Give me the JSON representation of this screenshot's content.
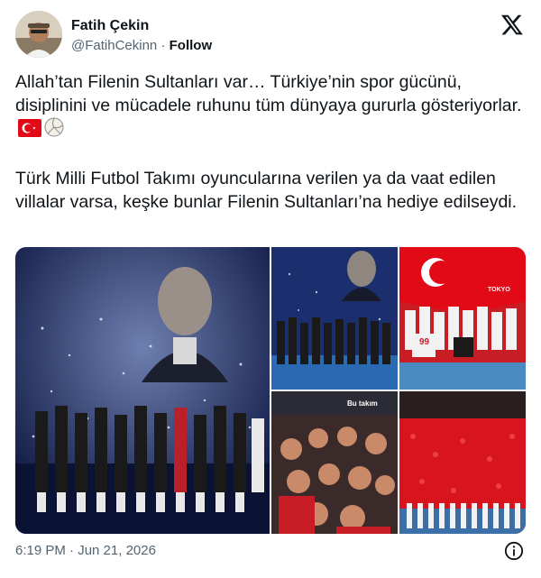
{
  "author": {
    "display_name": "Fatih Çekin",
    "handle": "@FatihCekinn",
    "separator": "·",
    "follow_label": "Follow"
  },
  "tweet": {
    "paragraph1": "Allah’tan Filenin Sultanları var… Türkiye’nin spor gücünü, disiplinini ve mücadele ruhunu tüm dünyaya gururla gösteriyorlar.",
    "paragraph2": "Türk Milli Futbol Takımı oyuncularına verilen ya da vaat edilen villalar varsa, keşke bunlar Filenin Sultanları’na hediye edilseydi.",
    "emojis": [
      "turkey-flag-icon",
      "volleyball-icon"
    ]
  },
  "media": {
    "story_caption": "Bu takım",
    "arena_banner": "TOKYO",
    "jersey_number": "99"
  },
  "footer": {
    "timestamp": "6:19 PM · Jun 21, 2026"
  },
  "colors": {
    "text_primary": "#0f1419",
    "text_secondary": "#536471",
    "turkey_red": "#e30a17",
    "arena_blue": "#1b2f6e"
  },
  "icons": {
    "platform_logo": "x-logo-icon",
    "info": "info-icon"
  }
}
